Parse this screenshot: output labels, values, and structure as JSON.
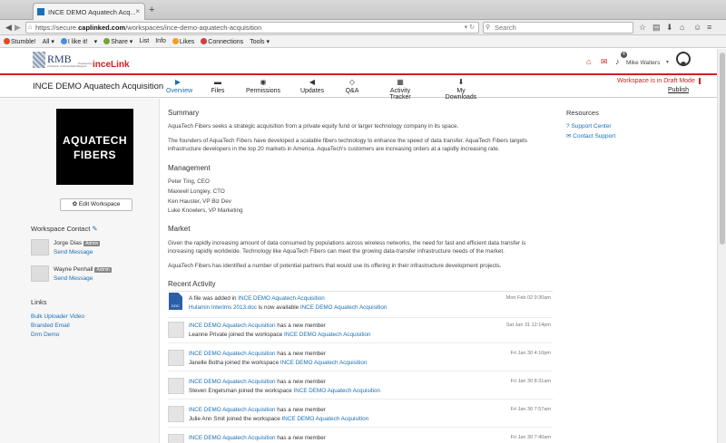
{
  "browser": {
    "tab_title": "INCE DEMO Aquatech Acq...",
    "tab_close": "×",
    "new_tab": "+",
    "url_prefix": "https://secure.",
    "url_host": "caplinked.com",
    "url_path": "/workspaces/ince-demo-aquatech-acquisition",
    "search_placeholder": "Search",
    "bookmarks": [
      "Stumble!",
      "All ▾",
      "I like it!",
      "▾",
      "Share ▾",
      "List",
      "Info",
      "Likes",
      "Connections",
      "Tools ▾"
    ]
  },
  "header": {
    "logo_main": "RMB",
    "logo_sub": "A Division of Rosenblatt Mergers",
    "powered_by": "Powered by",
    "partner_logo": "inceLink",
    "notification_count": "4",
    "user_name": "Mike Walters",
    "user_caret": "▾"
  },
  "workspace": {
    "title": "INCE DEMO Aquatech Acquisition",
    "nav": [
      {
        "label": "Overview",
        "icon": "▶"
      },
      {
        "label": "Files",
        "icon": "▬"
      },
      {
        "label": "Permissions",
        "icon": "◉"
      },
      {
        "label": "Updates",
        "icon": "◀"
      },
      {
        "label": "Q&A",
        "icon": "◇"
      },
      {
        "label": "Activity Tracker",
        "icon": "▦"
      },
      {
        "label": "My Downloads",
        "icon": "⬇"
      }
    ],
    "draft_notice": "Workspace is in Draft Mode",
    "publish_label": "Publish"
  },
  "sidebar": {
    "brand_line1": "AQUATECH",
    "brand_line2": "FIBERS",
    "edit_button": "✿ Edit Workspace",
    "contact_heading": "Workspace Contact",
    "contacts": [
      {
        "name": "Jorge Dias",
        "badge": "Admin",
        "action": "Send Message"
      },
      {
        "name": "Wayne Penhall",
        "badge": "Admin",
        "action": "Send Message"
      }
    ],
    "links_heading": "Links",
    "links": [
      "Bulk Uploader Video",
      "Branded Email",
      "Drm Demo"
    ]
  },
  "main": {
    "summary_heading": "Summary",
    "summary_p1": "AquaTech Fibers seeks a strategic acquisition from a private equity fund or larger technology company in its space.",
    "summary_p2": "The founders of AquaTech Fibers have developed a scalable fibers technology to enhance the speed of data transfer. AquaTech Fibers targets infrastructure developers in the top 20 markets in America. AquaTech's customers are increasing orders at a rapidly increasing rate.",
    "management_heading": "Management",
    "management": [
      "Peter Ting, CEO",
      "Maxwell Longley, CTO",
      "Ken Hauster, VP Biz Dev",
      "Luke Knowlers, VP Marketing"
    ],
    "market_heading": "Market",
    "market_p1": "Given the rapidly increasing amount of data consumed by populations across wireless networks, the need for fast and efficient data transfer is increasing rapidly worldwide. Technology like AquaTech Fibers can meet the growing data-transfer infrastructure needs of the market.",
    "market_p2": "AquaTech Fibers has identified a number of potential partners that would use its offering in their infrastructure development projects.",
    "activity_heading": "Recent Activity",
    "activity": [
      {
        "l1a": "A file was added in ",
        "l1b": "INCE DEMO Aquatech Acquisition",
        "l2a": "Hulamin Interims 2013.doc",
        "l2b": " is now available ",
        "l2c": "INCE DEMO Aquatech Acquisition",
        "time": "Mon Feb 02 9:30am",
        "doc": "DOC"
      },
      {
        "l1a": "INCE DEMO Aquatech Acquisition",
        "l1b": " has a new member",
        "l2a": "Leanne Private joined the workspace ",
        "l2b": "INCE DEMO Aquatech Acquisition",
        "time": "Sat Jan 31 12:14pm"
      },
      {
        "l1a": "INCE DEMO Aquatech Acquisition",
        "l1b": " has a new member",
        "l2a": "Janelle Botha joined the workspace ",
        "l2b": "INCE DEMO Aquatech Acquisition",
        "time": "Fri Jan 30 4:10pm"
      },
      {
        "l1a": "INCE DEMO Aquatech Acquisition",
        "l1b": " has a new member",
        "l2a": "Steven Engelsman joined the workspace ",
        "l2b": "INCE DEMO Aquatech Acquisition",
        "time": "Fri Jan 30 8:31am"
      },
      {
        "l1a": "INCE DEMO Aquatech Acquisition",
        "l1b": " has a new member",
        "l2a": "Julie Ann Smit joined the workspace ",
        "l2b": "INCE DEMO Aquatech Acquisition",
        "time": "Fri Jan 30 7:57am"
      },
      {
        "l1a": "INCE DEMO Aquatech Acquisition",
        "l1b": " has a new member",
        "l2a": "",
        "l2b": "",
        "time": "Fri Jan 30 7:40am"
      }
    ]
  },
  "resources": {
    "heading": "Resources",
    "links": [
      "Support Center",
      "Contact Support"
    ]
  }
}
